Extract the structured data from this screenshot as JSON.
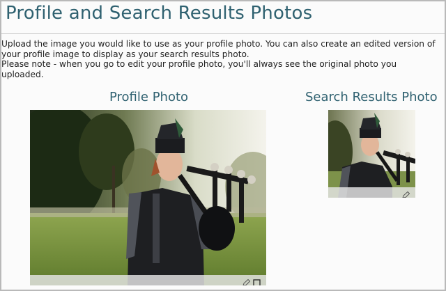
{
  "page": {
    "title": "Profile and Search Results Photos"
  },
  "intro": {
    "line1": "Upload the image you would like to use as your profile photo. You can also create an edited version of your profile image to display as your search results photo.",
    "line2": "Please note - when you go to edit your profile photo, you'll always see the original photo you uploaded."
  },
  "profile_photo": {
    "heading": "Profile Photo",
    "icons": [
      "pencil-icon",
      "crop-icon"
    ]
  },
  "search_results_photo": {
    "heading": "Search Results Photo",
    "icons": [
      "pencil-icon"
    ]
  },
  "colors": {
    "heading": "#2f6170",
    "body_text": "#222222",
    "background": "#fbfbfb"
  }
}
